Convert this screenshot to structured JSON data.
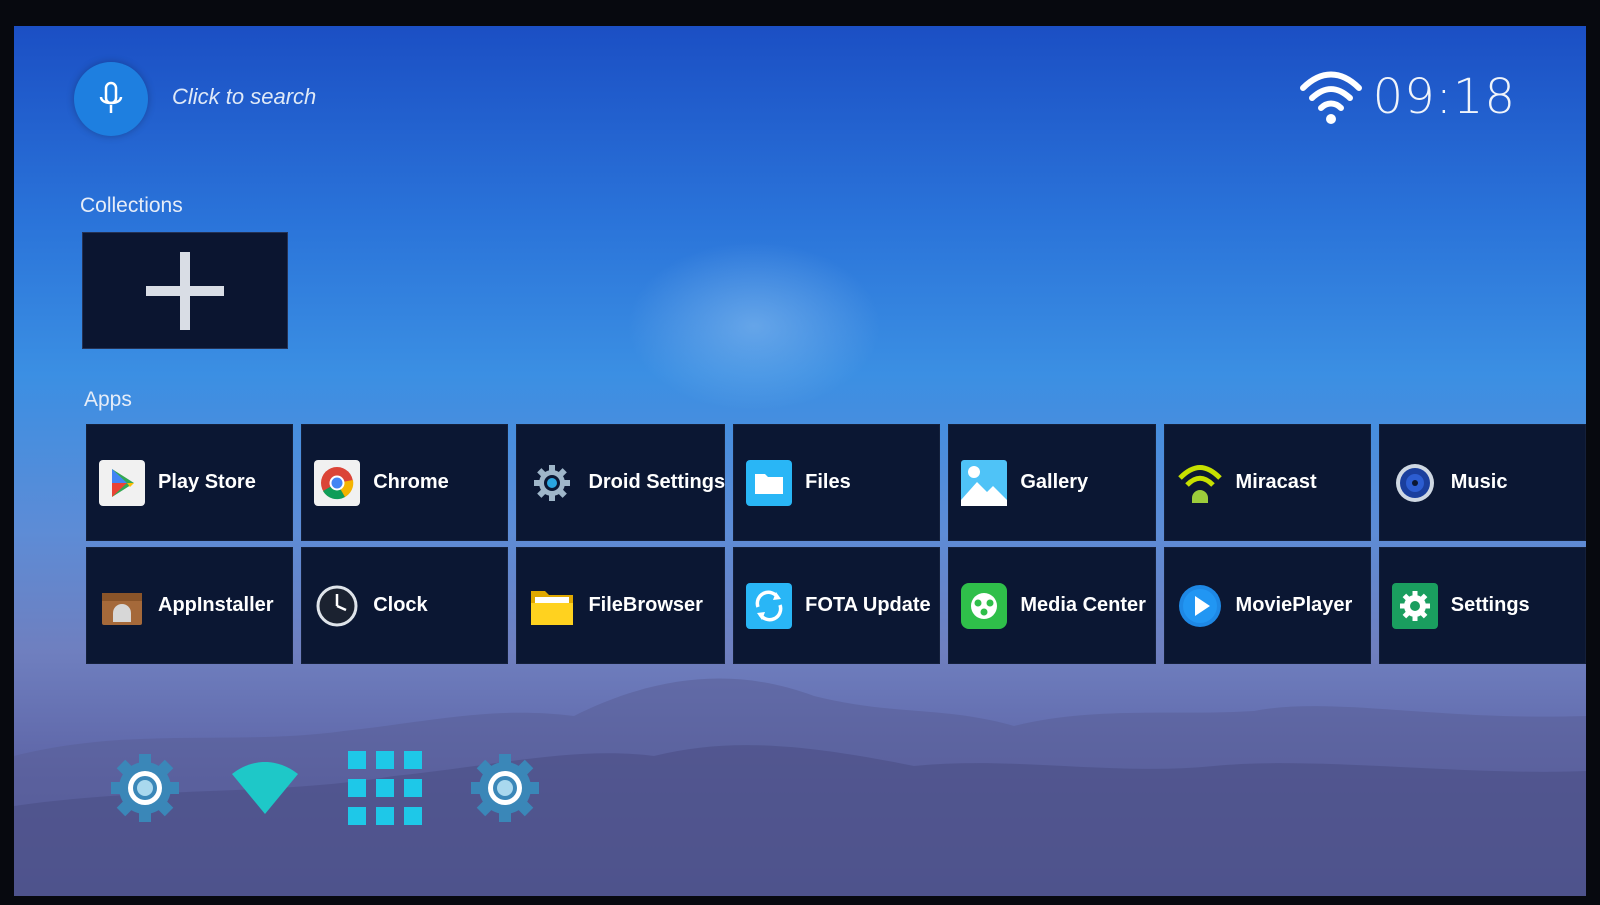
{
  "search": {
    "placeholder": "Click to search",
    "icon": "microphone-icon"
  },
  "status_bar": {
    "time": "09:18",
    "wifi_icon": "wifi-icon"
  },
  "collections": {
    "title": "Collections",
    "add_icon": "plus-icon"
  },
  "apps": {
    "title": "Apps",
    "items": [
      {
        "label": "Play Store",
        "icon": "play-store-icon"
      },
      {
        "label": "Chrome",
        "icon": "chrome-icon"
      },
      {
        "label": "Droid Settings",
        "icon": "gear-icon"
      },
      {
        "label": "Files",
        "icon": "folder-icon"
      },
      {
        "label": "Gallery",
        "icon": "gallery-icon"
      },
      {
        "label": "Miracast",
        "icon": "miracast-icon"
      },
      {
        "label": "Music",
        "icon": "music-icon"
      },
      {
        "label": "AppInstaller",
        "icon": "app-installer-icon"
      },
      {
        "label": "Clock",
        "icon": "clock-icon"
      },
      {
        "label": "FileBrowser",
        "icon": "folder-icon"
      },
      {
        "label": "FOTA Update",
        "icon": "update-icon"
      },
      {
        "label": "Media Center",
        "icon": "media-center-icon"
      },
      {
        "label": "MoviePlayer",
        "icon": "play-icon"
      },
      {
        "label": "Settings",
        "icon": "settings-icon"
      }
    ]
  },
  "dock": [
    {
      "icon": "settings-gear-icon"
    },
    {
      "icon": "wifi-icon"
    },
    {
      "icon": "all-apps-grid-icon"
    },
    {
      "icon": "settings-gear-icon"
    }
  ],
  "colors": {
    "accent": "#1e7fe0",
    "tile_bg": "#0b1733",
    "dock_icon": "#1ec8e8"
  }
}
